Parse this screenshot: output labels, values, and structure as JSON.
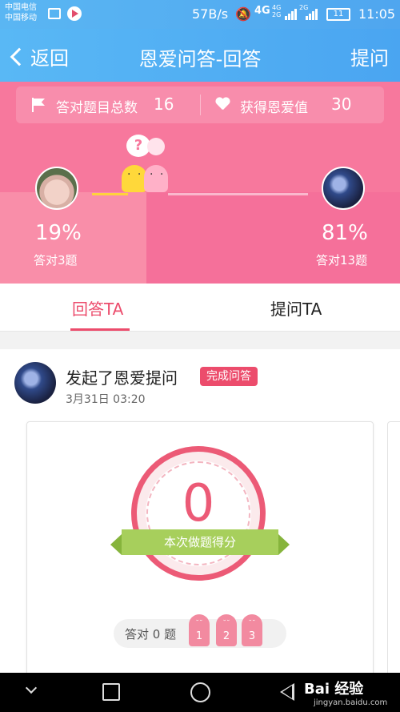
{
  "status_bar": {
    "carrier1": "中国电信",
    "carrier2": "中国移动",
    "speed": "57B/s",
    "network": "4G",
    "sig1_top": "4G",
    "sig1_bottom": "2G",
    "sig2_top": "2G",
    "battery": "11",
    "time": "11:05"
  },
  "nav": {
    "back_label": "返回",
    "title": "恩爱问答-回答",
    "action_label": "提问"
  },
  "stats": {
    "correct_total_label": "答对题目总数",
    "correct_total_value": "16",
    "love_label": "获得恩爱值",
    "love_value": "30",
    "bubble_text": "?",
    "left": {
      "percent": "19%",
      "sub": "答对3题"
    },
    "right": {
      "percent": "81%",
      "sub": "答对13题"
    }
  },
  "tabs": [
    {
      "label": "回答TA",
      "active": true
    },
    {
      "label": "提问TA",
      "active": false
    }
  ],
  "feed": {
    "title": "发起了恩爱提问",
    "badge": "完成问答",
    "time": "3月31日 03:20",
    "score": "0",
    "score_caption": "本次做题得分",
    "correct_label": "答对 0 题",
    "medals": [
      "1",
      "2",
      "3"
    ]
  },
  "watermark": {
    "brand": "Bai 经验",
    "url": "jingyan.baidu.com"
  },
  "colors": {
    "accent": "#ec4c6c",
    "nav_blue": "#4fa6ef",
    "pink": "#f7789d",
    "ribbon_green": "#a7cf5c"
  }
}
